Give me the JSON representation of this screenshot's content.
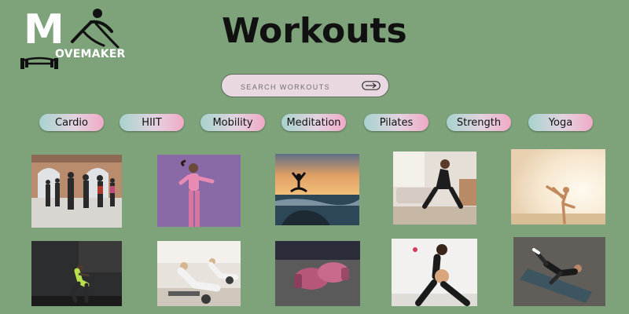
{
  "brand": {
    "logo_letter": "M",
    "logo_word": "OVEMAKER"
  },
  "page": {
    "title": "Workouts"
  },
  "search": {
    "placeholder": "SEARCH WORKOUTS",
    "icon": "arrow-right-icon"
  },
  "filters": [
    "Cardio",
    "HIIT",
    "Mobility",
    "Meditation",
    "Pilates",
    "Strength",
    "Yoga"
  ],
  "workouts": [
    {
      "image": "group-cardio-class-photo"
    },
    {
      "image": "woman-stretching-photo"
    },
    {
      "image": "sunset-meditation-photo"
    },
    {
      "image": "home-stretch-photo"
    },
    {
      "image": "sunlit-yoga-pose-photo"
    },
    {
      "image": "gym-squat-photo"
    },
    {
      "image": "pilates-class-photo"
    },
    {
      "image": "boxing-gloves-photo"
    },
    {
      "image": "prenatal-stretch-photo"
    },
    {
      "image": "bicycle-crunch-photo"
    }
  ]
}
